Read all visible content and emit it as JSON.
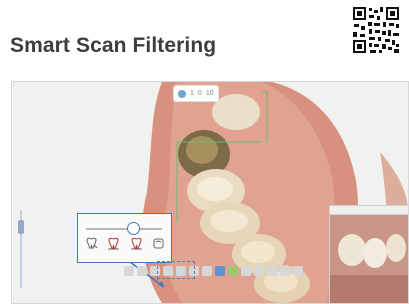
{
  "heading": {
    "title": "Smart Scan Filtering"
  },
  "viewer": {
    "topbar_values": [
      "1",
      "0",
      "10"
    ],
    "side_slider_level": 0.15,
    "filter_slider_level": 0.62,
    "icons": {
      "qr": "qr-code-icon",
      "tooth_filter": "tooth-filter-icon",
      "tooth_a": "tooth-outline-icon",
      "tooth_b": "tooth-outline-icon",
      "tooth_c": "tooth-square-icon"
    },
    "colors": {
      "accent": "#3f78c2",
      "gum": "#d98d7b",
      "tooth": "#e7d8bd",
      "gold": "#8f7a4c",
      "scan_bg": "#f1f1f0"
    }
  }
}
